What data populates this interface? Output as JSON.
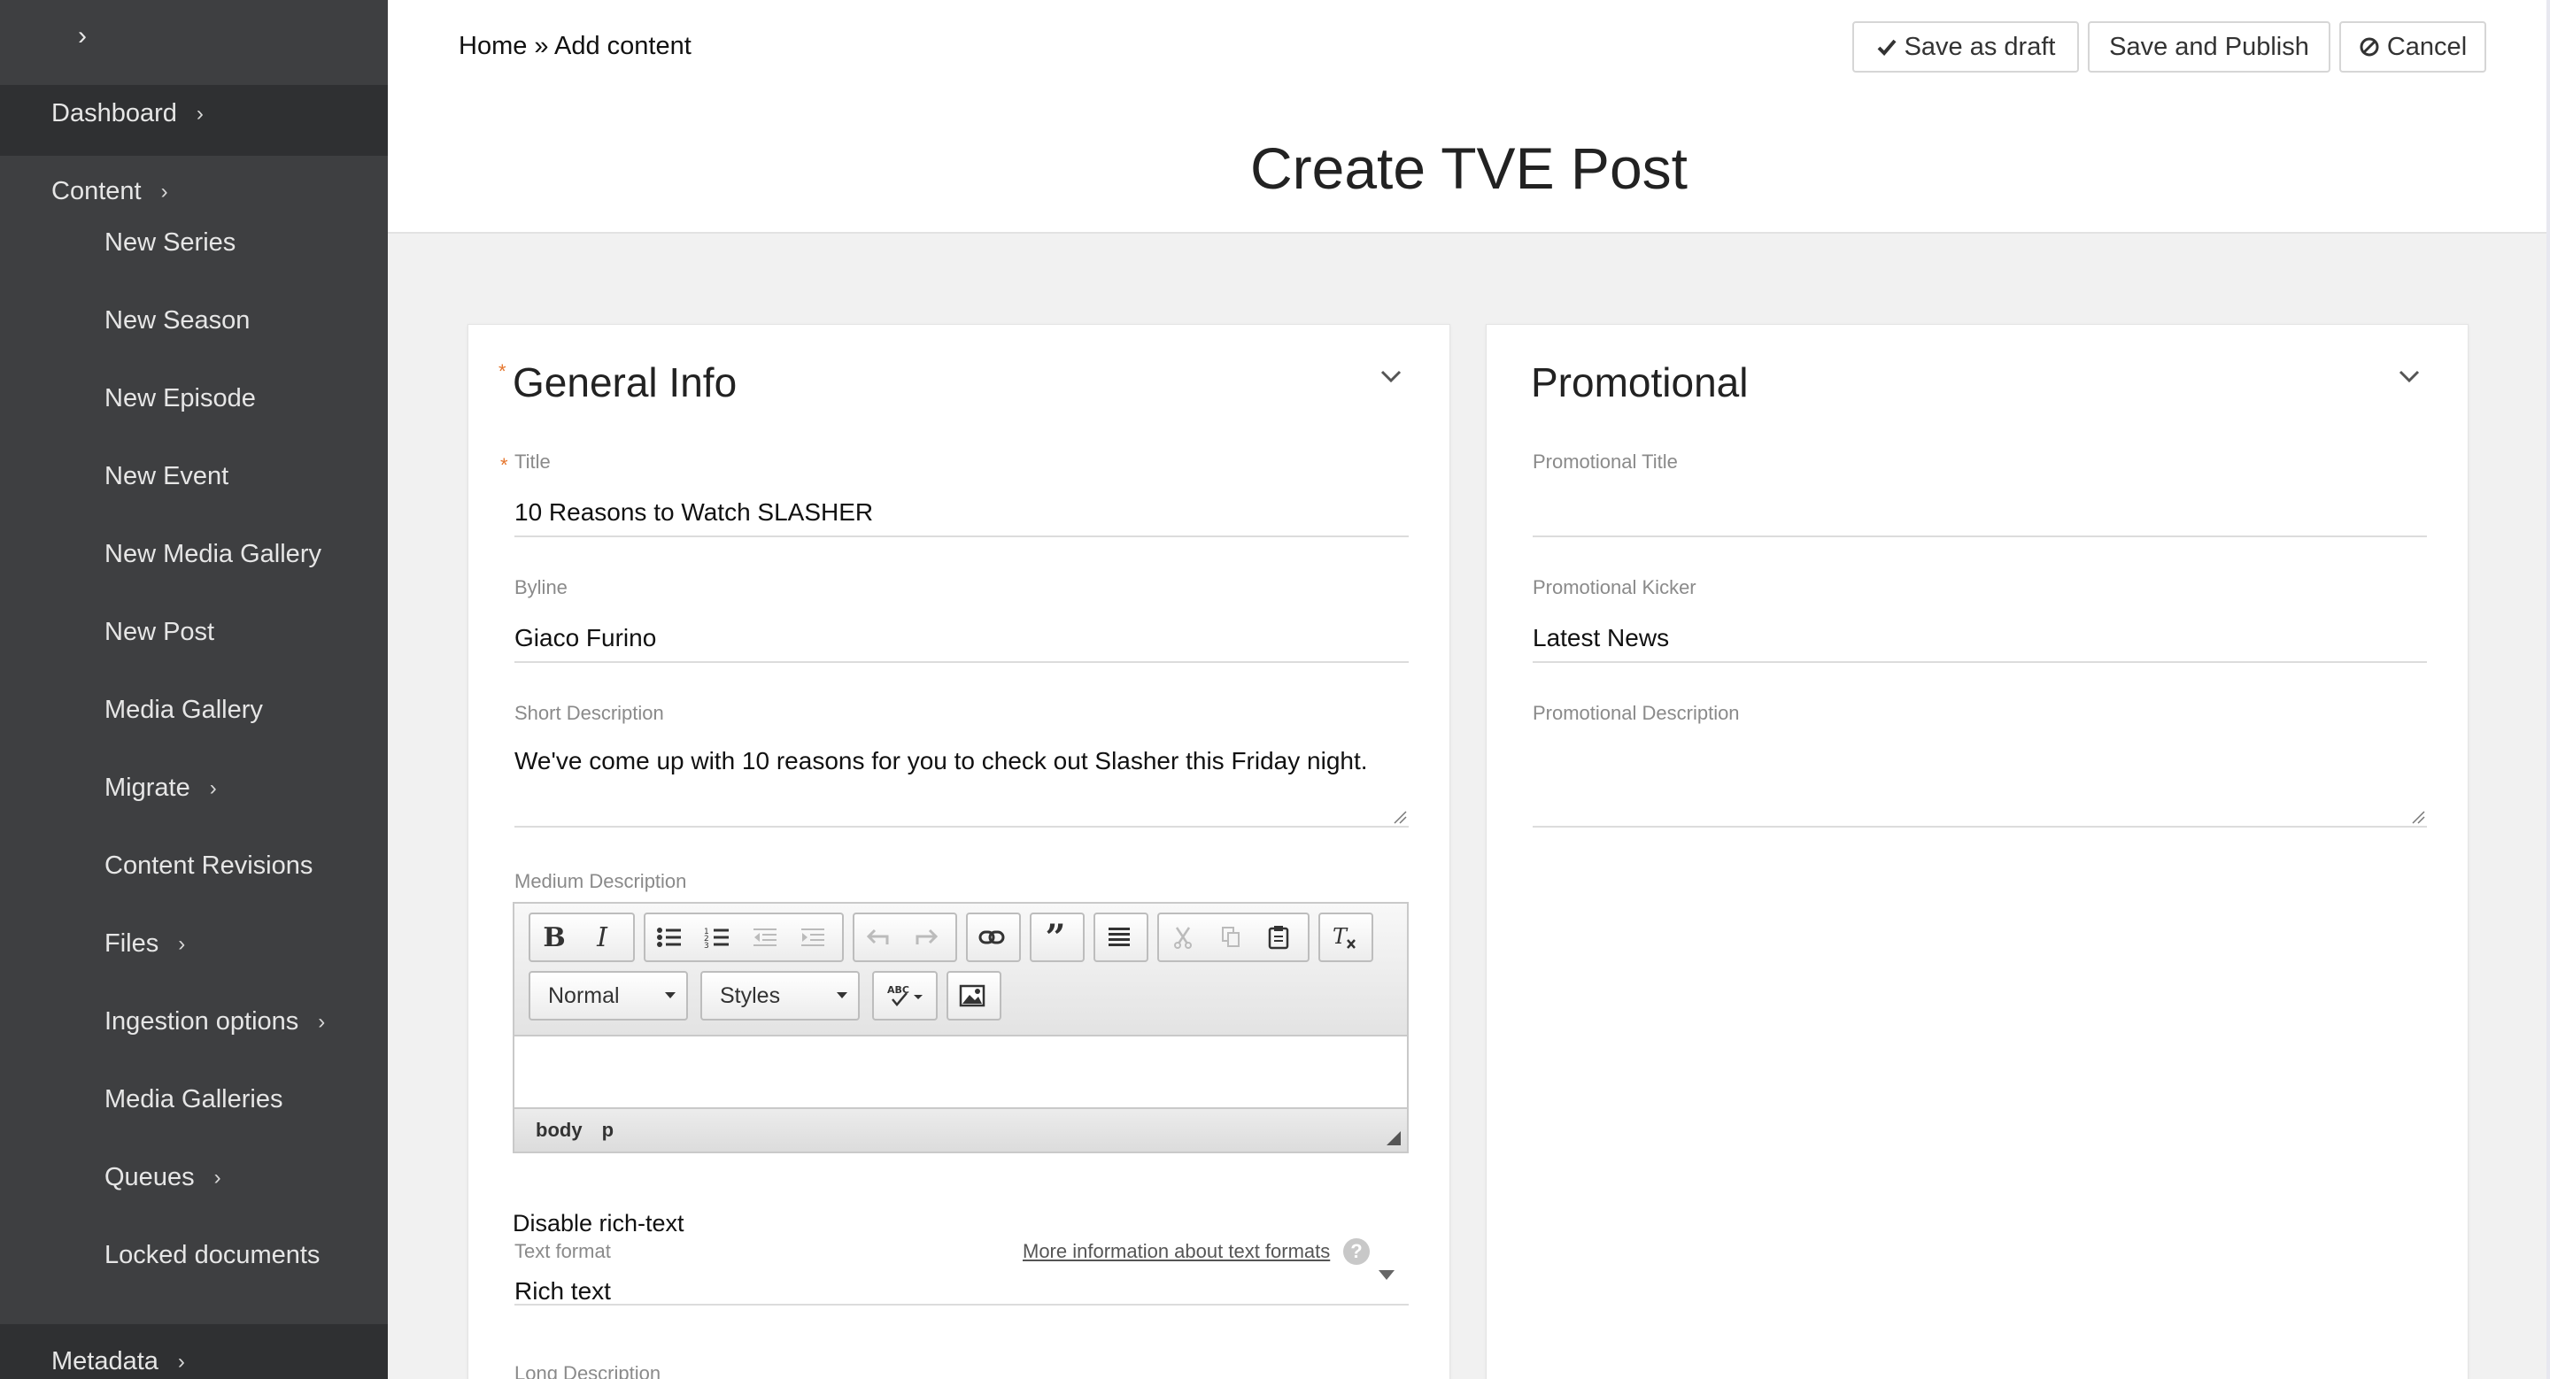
{
  "sidebar": {
    "toggle_icon": "chevron-right-icon",
    "items": [
      {
        "label": "Dashboard",
        "has_chevron": true
      },
      {
        "label": "Content",
        "has_chevron": true
      },
      {
        "label": "New Series"
      },
      {
        "label": "New Season"
      },
      {
        "label": "New Episode"
      },
      {
        "label": "New Event"
      },
      {
        "label": "New Media Gallery"
      },
      {
        "label": "New Post"
      },
      {
        "label": "Media Gallery"
      },
      {
        "label": "Migrate",
        "has_chevron": true
      },
      {
        "label": "Content Revisions"
      },
      {
        "label": "Files",
        "has_chevron": true
      },
      {
        "label": "Ingestion options",
        "has_chevron": true
      },
      {
        "label": "Media Galleries"
      },
      {
        "label": "Queues",
        "has_chevron": true
      },
      {
        "label": "Locked documents"
      },
      {
        "label": "Metadata",
        "has_chevron": true
      }
    ],
    "chevron": "›"
  },
  "header": {
    "breadcrumb": "Home » Add content",
    "save_draft_label": "Save as draft",
    "save_publish_label": "Save and Publish",
    "cancel_label": "Cancel",
    "page_title": "Create TVE Post"
  },
  "general_info": {
    "title": "General Info",
    "title_field": {
      "label": "Title",
      "value": "10 Reasons to Watch SLASHER"
    },
    "byline": {
      "label": "Byline",
      "value": "Giaco Furino"
    },
    "short_description": {
      "label": "Short Description",
      "value": "We've come up with 10 reasons for you to check out Slasher this Friday night."
    },
    "medium_description": {
      "label": "Medium Description",
      "format_combo": "Normal",
      "styles_combo": "Styles",
      "path": [
        "body",
        "p"
      ]
    },
    "disable_rich_text": "Disable rich-text",
    "text_format": {
      "label": "Text format",
      "value": "Rich text",
      "help_link": "More information about text formats",
      "help_icon": "?"
    },
    "long_description": {
      "label": "Long Description"
    }
  },
  "promotional": {
    "title": "Promotional",
    "promo_title": {
      "label": "Promotional Title",
      "value": ""
    },
    "promo_kicker": {
      "label": "Promotional Kicker",
      "value": "Latest News"
    },
    "promo_description": {
      "label": "Promotional Description",
      "value": ""
    }
  },
  "colors": {
    "sidebar_bg": "#3e3f41",
    "sidebar_active_bg": "#2f3032",
    "required_star": "#e5752c"
  }
}
